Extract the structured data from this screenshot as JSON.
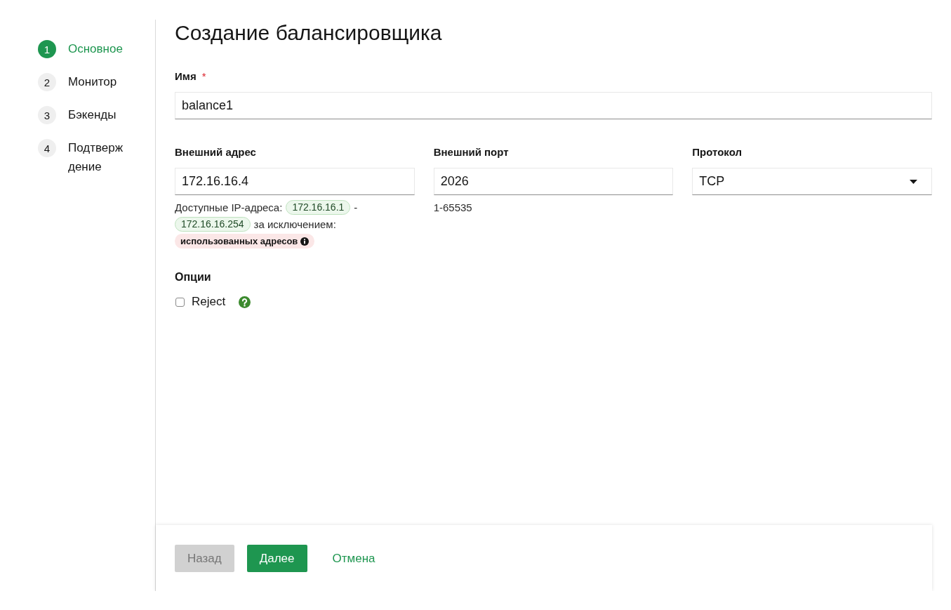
{
  "steps": [
    {
      "number": "1",
      "label": "Основное",
      "selected": true
    },
    {
      "number": "2",
      "label": "Монитор",
      "selected": false
    },
    {
      "number": "3",
      "label": "Бэкенды",
      "selected": false
    },
    {
      "number": "4",
      "label": "Подтверждение",
      "selected": false
    }
  ],
  "title": "Создание балансировщика",
  "name_field": {
    "label": "Имя",
    "required_mark": "*",
    "value": "balance1"
  },
  "address_fields": [
    {
      "kind": "input",
      "label": "Внешний адрес",
      "value": "172.16.16.4",
      "hint": [
        {
          "kind": "text",
          "text": "Доступные IP-адреса:"
        },
        {
          "kind": "range",
          "text": "172.16.16.1"
        },
        {
          "kind": "text",
          "text": "-"
        },
        {
          "kind": "range",
          "text": "172.16.16.254"
        },
        {
          "kind": "text",
          "text": "за исключением:"
        },
        {
          "kind": "excluded",
          "text": "использованных адресов"
        }
      ]
    },
    {
      "kind": "input",
      "label": "Внешний порт",
      "value": "2026",
      "hint": [
        {
          "kind": "text",
          "text": "1-65535"
        }
      ]
    },
    {
      "kind": "select",
      "label": "Протокол",
      "value": "TCP"
    }
  ],
  "options": {
    "title": "Опции",
    "items": [
      {
        "label": "Reject",
        "checked": false
      }
    ]
  },
  "footer_buttons": [
    {
      "kind": "secondary",
      "label": "Назад",
      "disabled": true
    },
    {
      "kind": "primary",
      "label": "Далее",
      "disabled": false
    },
    {
      "kind": "link",
      "label": "Отмена",
      "disabled": false
    }
  ]
}
